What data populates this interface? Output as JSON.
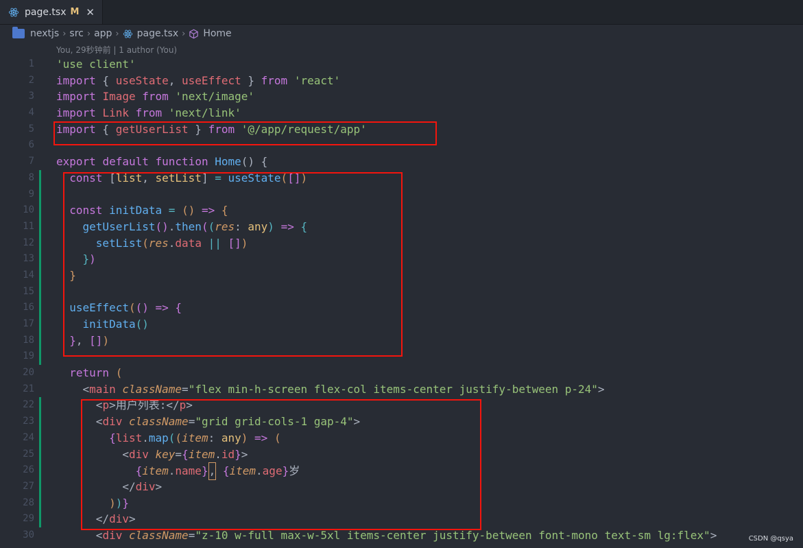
{
  "tab": {
    "filename": "page.tsx",
    "modified": "M",
    "close": "✕"
  },
  "breadcrumb": [
    "nextjs",
    "src",
    "app",
    "page.tsx",
    "Home"
  ],
  "blame": "You, 29秒钟前 | 1 author (You)",
  "lines": [
    {
      "n": "1",
      "tokens": [
        [
          "'use client'",
          "s"
        ]
      ]
    },
    {
      "n": "2",
      "tokens": [
        [
          "import",
          "k"
        ],
        [
          " { ",
          "p"
        ],
        [
          "useState",
          "v"
        ],
        [
          ", ",
          "p"
        ],
        [
          "useEffect",
          "v"
        ],
        [
          " } ",
          "p"
        ],
        [
          "from",
          "k"
        ],
        [
          " ",
          "p"
        ],
        [
          "'react'",
          "s"
        ]
      ]
    },
    {
      "n": "3",
      "tokens": [
        [
          "import",
          "k"
        ],
        [
          " ",
          "p"
        ],
        [
          "Image",
          "v"
        ],
        [
          " ",
          "p"
        ],
        [
          "from",
          "k"
        ],
        [
          " ",
          "p"
        ],
        [
          "'next/image'",
          "s"
        ]
      ]
    },
    {
      "n": "4",
      "tokens": [
        [
          "import",
          "k"
        ],
        [
          " ",
          "p"
        ],
        [
          "Link",
          "v"
        ],
        [
          " ",
          "p"
        ],
        [
          "from",
          "k"
        ],
        [
          " ",
          "p"
        ],
        [
          "'next/link'",
          "s"
        ]
      ]
    },
    {
      "n": "5",
      "tokens": [
        [
          "import",
          "k"
        ],
        [
          " { ",
          "p"
        ],
        [
          "getUserList",
          "v"
        ],
        [
          " } ",
          "p"
        ],
        [
          "from",
          "k"
        ],
        [
          " ",
          "p"
        ],
        [
          "'@/app/request/app'",
          "s"
        ]
      ]
    },
    {
      "n": "6",
      "tokens": []
    },
    {
      "n": "7",
      "tokens": [
        [
          "export",
          "k"
        ],
        [
          " ",
          "p"
        ],
        [
          "default",
          "k"
        ],
        [
          " ",
          "p"
        ],
        [
          "function",
          "k"
        ],
        [
          " ",
          "p"
        ],
        [
          "Home",
          "f"
        ],
        [
          "() {",
          "p"
        ]
      ]
    },
    {
      "n": "8",
      "gm": true,
      "tokens": [
        [
          "  ",
          "p"
        ],
        [
          "const",
          "k"
        ],
        [
          " [",
          "p"
        ],
        [
          "list",
          "t"
        ],
        [
          ", ",
          "p"
        ],
        [
          "setList",
          "t"
        ],
        [
          "] ",
          "p"
        ],
        [
          "=",
          "o"
        ],
        [
          " ",
          "p"
        ],
        [
          "useState",
          "f"
        ],
        [
          "(",
          "b1"
        ],
        [
          "[]",
          "b2"
        ],
        [
          ")",
          "b1"
        ]
      ]
    },
    {
      "n": "9",
      "gm": true,
      "tokens": []
    },
    {
      "n": "10",
      "gm": true,
      "tokens": [
        [
          "  ",
          "p"
        ],
        [
          "const",
          "k"
        ],
        [
          " ",
          "p"
        ],
        [
          "initData",
          "f"
        ],
        [
          " ",
          "p"
        ],
        [
          "=",
          "o"
        ],
        [
          " ",
          "p"
        ],
        [
          "()",
          "b1"
        ],
        [
          " ",
          "p"
        ],
        [
          "=>",
          "k"
        ],
        [
          " ",
          "p"
        ],
        [
          "{",
          "b1"
        ]
      ]
    },
    {
      "n": "11",
      "gm": true,
      "tokens": [
        [
          "    ",
          "p"
        ],
        [
          "getUserList",
          "f"
        ],
        [
          "()",
          "b2"
        ],
        [
          ".",
          "p"
        ],
        [
          "then",
          "f"
        ],
        [
          "(",
          "b2"
        ],
        [
          "(",
          "b3"
        ],
        [
          "res",
          "a"
        ],
        [
          ": ",
          "p"
        ],
        [
          "any",
          "t"
        ],
        [
          ")",
          "b3"
        ],
        [
          " ",
          "p"
        ],
        [
          "=>",
          "k"
        ],
        [
          " ",
          "p"
        ],
        [
          "{",
          "b3"
        ]
      ]
    },
    {
      "n": "12",
      "gm": true,
      "tokens": [
        [
          "      ",
          "p"
        ],
        [
          "setList",
          "f"
        ],
        [
          "(",
          "b1"
        ],
        [
          "res",
          "a"
        ],
        [
          ".",
          "p"
        ],
        [
          "data",
          "v"
        ],
        [
          " ",
          "p"
        ],
        [
          "||",
          "o"
        ],
        [
          " ",
          "p"
        ],
        [
          "[]",
          "b2"
        ],
        [
          ")",
          "b1"
        ]
      ]
    },
    {
      "n": "13",
      "gm": true,
      "tokens": [
        [
          "    ",
          "p"
        ],
        [
          "}",
          "b3"
        ],
        [
          ")",
          "b2"
        ]
      ]
    },
    {
      "n": "14",
      "gm": true,
      "tokens": [
        [
          "  ",
          "p"
        ],
        [
          "}",
          "b1"
        ]
      ]
    },
    {
      "n": "15",
      "gm": true,
      "tokens": []
    },
    {
      "n": "16",
      "gm": true,
      "tokens": [
        [
          "  ",
          "p"
        ],
        [
          "useEffect",
          "f"
        ],
        [
          "(",
          "b1"
        ],
        [
          "()",
          "b2"
        ],
        [
          " ",
          "p"
        ],
        [
          "=>",
          "k"
        ],
        [
          " ",
          "p"
        ],
        [
          "{",
          "b2"
        ]
      ]
    },
    {
      "n": "17",
      "gm": true,
      "tokens": [
        [
          "    ",
          "p"
        ],
        [
          "initData",
          "f"
        ],
        [
          "()",
          "b3"
        ]
      ]
    },
    {
      "n": "18",
      "gm": true,
      "tokens": [
        [
          "  ",
          "p"
        ],
        [
          "}",
          "b2"
        ],
        [
          ", ",
          "p"
        ],
        [
          "[]",
          "b2"
        ],
        [
          ")",
          "b1"
        ]
      ]
    },
    {
      "n": "19",
      "gm": true,
      "tokens": []
    },
    {
      "n": "20",
      "tokens": [
        [
          "  ",
          "p"
        ],
        [
          "return",
          "k"
        ],
        [
          " ",
          "p"
        ],
        [
          "(",
          "b1"
        ]
      ]
    },
    {
      "n": "21",
      "tokens": [
        [
          "    ",
          "p"
        ],
        [
          "<",
          "p"
        ],
        [
          "main",
          "v"
        ],
        [
          " ",
          "p"
        ],
        [
          "className",
          "a"
        ],
        [
          "=",
          "p"
        ],
        [
          "\"flex min-h-screen flex-col items-center justify-between p-24\"",
          "s"
        ],
        [
          ">",
          "p"
        ]
      ]
    },
    {
      "n": "22",
      "gm": true,
      "tokens": [
        [
          "      ",
          "p"
        ],
        [
          "<",
          "p"
        ],
        [
          "p",
          "v"
        ],
        [
          ">",
          "p"
        ],
        [
          "用户列表:",
          "p"
        ],
        [
          "</",
          "p"
        ],
        [
          "p",
          "v"
        ],
        [
          ">",
          "p"
        ]
      ]
    },
    {
      "n": "23",
      "gm": true,
      "tokens": [
        [
          "      ",
          "p"
        ],
        [
          "<",
          "p"
        ],
        [
          "div",
          "v"
        ],
        [
          " ",
          "p"
        ],
        [
          "className",
          "a"
        ],
        [
          "=",
          "p"
        ],
        [
          "\"grid grid-cols-1 gap-4\"",
          "s"
        ],
        [
          ">",
          "p"
        ]
      ]
    },
    {
      "n": "24",
      "gm": true,
      "tokens": [
        [
          "        ",
          "p"
        ],
        [
          "{",
          "b2"
        ],
        [
          "list",
          "v"
        ],
        [
          ".",
          "p"
        ],
        [
          "map",
          "f"
        ],
        [
          "(",
          "b3"
        ],
        [
          "(",
          "b1"
        ],
        [
          "item",
          "a"
        ],
        [
          ": ",
          "p"
        ],
        [
          "any",
          "t"
        ],
        [
          ")",
          "b1"
        ],
        [
          " ",
          "p"
        ],
        [
          "=>",
          "k"
        ],
        [
          " ",
          "p"
        ],
        [
          "(",
          "b1"
        ]
      ]
    },
    {
      "n": "25",
      "gm": true,
      "tokens": [
        [
          "          ",
          "p"
        ],
        [
          "<",
          "p"
        ],
        [
          "div",
          "v"
        ],
        [
          " ",
          "p"
        ],
        [
          "key",
          "a"
        ],
        [
          "=",
          "p"
        ],
        [
          "{",
          "b2"
        ],
        [
          "item",
          "a"
        ],
        [
          ".",
          "p"
        ],
        [
          "id",
          "v"
        ],
        [
          "}",
          "b2"
        ],
        [
          ">",
          "p"
        ]
      ]
    },
    {
      "n": "26",
      "gm": true,
      "tokens": [
        [
          "            ",
          "p"
        ],
        [
          "{",
          "b2"
        ],
        [
          "item",
          "a"
        ],
        [
          ".",
          "p"
        ],
        [
          "name",
          "v"
        ],
        [
          "}",
          "b2"
        ],
        [
          "CURSOR,",
          "p"
        ],
        [
          " ",
          "p"
        ],
        [
          "{",
          "b2"
        ],
        [
          "item",
          "a"
        ],
        [
          ".",
          "p"
        ],
        [
          "age",
          "v"
        ],
        [
          "}",
          "b2"
        ],
        [
          "岁",
          "p"
        ]
      ]
    },
    {
      "n": "27",
      "gm": true,
      "tokens": [
        [
          "          ",
          "p"
        ],
        [
          "</",
          "p"
        ],
        [
          "div",
          "v"
        ],
        [
          ">",
          "p"
        ]
      ]
    },
    {
      "n": "28",
      "gm": true,
      "tokens": [
        [
          "        ",
          "p"
        ],
        [
          ")",
          "b1"
        ],
        [
          ")",
          "b3"
        ],
        [
          "}",
          "b2"
        ]
      ]
    },
    {
      "n": "29",
      "gm": true,
      "tokens": [
        [
          "      ",
          "p"
        ],
        [
          "</",
          "p"
        ],
        [
          "div",
          "v"
        ],
        [
          ">",
          "p"
        ]
      ]
    },
    {
      "n": "30",
      "tokens": [
        [
          "      ",
          "p"
        ],
        [
          "<",
          "p"
        ],
        [
          "div",
          "v"
        ],
        [
          " ",
          "p"
        ],
        [
          "className",
          "a"
        ],
        [
          "=",
          "p"
        ],
        [
          "\"z-10 w-full max-w-5xl items-center justify-between font-mono text-sm lg:flex\"",
          "s"
        ],
        [
          ">",
          "p"
        ]
      ]
    }
  ],
  "watermark": "CSDN @qsya",
  "colors": {
    "highlight_box": "#f4150d",
    "git_added": "#109868"
  }
}
